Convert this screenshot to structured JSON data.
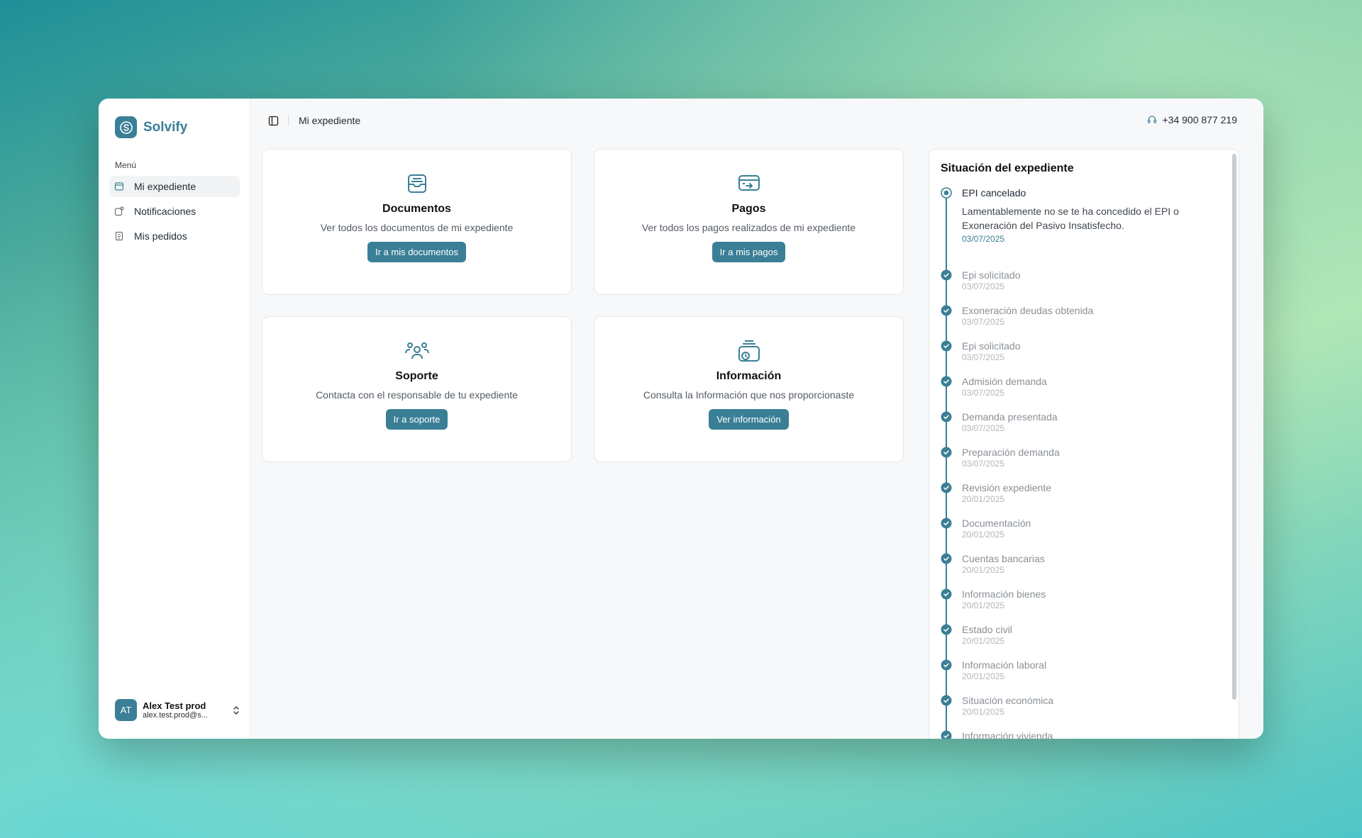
{
  "brand": {
    "name": "Solvify"
  },
  "sidebar": {
    "menu_label": "Menú",
    "items": [
      {
        "label": "Mi expediente",
        "icon": "folder-icon",
        "active": true
      },
      {
        "label": "Notificaciones",
        "icon": "bell-icon",
        "active": false
      },
      {
        "label": "Mis pedidos",
        "icon": "receipt-icon",
        "active": false
      }
    ]
  },
  "user": {
    "initials": "AT",
    "name": "Alex Test prod",
    "email": "alex.test.prod@s..."
  },
  "topbar": {
    "breadcrumb": "Mi expediente",
    "phone": "+34 900 877 219"
  },
  "cards": [
    {
      "title": "Documentos",
      "description": "Ver todos los documentos de mi expediente",
      "button": "Ir a mis documentos",
      "icon": "archive-icon"
    },
    {
      "title": "Pagos",
      "description": "Ver todos los pagos realizados de mi expediente",
      "button": "Ir a mis pagos",
      "icon": "payment-icon"
    },
    {
      "title": "Soporte",
      "description": "Contacta con el responsable de tu expediente",
      "button": "Ir a soporte",
      "icon": "people-icon"
    },
    {
      "title": "Información",
      "description": "Consulta la Información que nos proporcionaste",
      "button": "Ver información",
      "icon": "info-stack-icon"
    }
  ],
  "status": {
    "title": "Situación del expediente",
    "current": {
      "title": "EPI cancelado",
      "description": "Lamentablemente no se te ha concedido el EPI o Exoneración del Pasivo Insatisfecho.",
      "date": "03/07/2025"
    },
    "steps": [
      {
        "title": "Epi solicitado",
        "date": "03/07/2025"
      },
      {
        "title": "Exoneración deudas obtenida",
        "date": "03/07/2025"
      },
      {
        "title": "Epi solicitado",
        "date": "03/07/2025"
      },
      {
        "title": "Admisión demanda",
        "date": "03/07/2025"
      },
      {
        "title": "Demanda presentada",
        "date": "03/07/2025"
      },
      {
        "title": "Preparación demanda",
        "date": "03/07/2025"
      },
      {
        "title": "Revisión expediente",
        "date": "20/01/2025"
      },
      {
        "title": "Documentación",
        "date": "20/01/2025"
      },
      {
        "title": "Cuentas bancarias",
        "date": "20/01/2025"
      },
      {
        "title": "Información bienes",
        "date": "20/01/2025"
      },
      {
        "title": "Estado civil",
        "date": "20/01/2025"
      },
      {
        "title": "Información laboral",
        "date": "20/01/2025"
      },
      {
        "title": "Situación económica",
        "date": "20/01/2025"
      },
      {
        "title": "Información vivienda",
        "date": ""
      }
    ]
  },
  "colors": {
    "accent": "#3a7f96"
  }
}
